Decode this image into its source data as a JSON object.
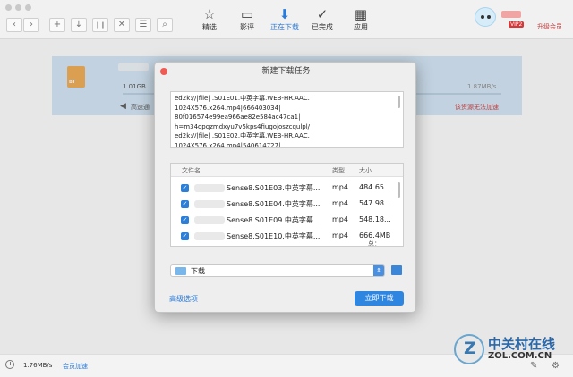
{
  "toolbar": {
    "nav": {
      "back": "‹",
      "forward": "›"
    },
    "actions": [
      {
        "name": "new-task-button",
        "glyph": "+"
      },
      {
        "name": "download-start-button",
        "glyph": "↓"
      },
      {
        "name": "pause-button",
        "glyph": "❙❙"
      },
      {
        "name": "delete-button",
        "glyph": "✕"
      },
      {
        "name": "list-button",
        "glyph": "☰"
      },
      {
        "name": "search-button",
        "glyph": "⌕"
      }
    ],
    "tabs": [
      {
        "label": "精选",
        "icon": "star-icon",
        "glyph": "☆"
      },
      {
        "label": "影评",
        "icon": "comment-icon",
        "glyph": "▭"
      },
      {
        "label": "正在下载",
        "icon": "download-icon",
        "glyph": "⬇"
      },
      {
        "label": "已完成",
        "icon": "check-icon",
        "glyph": "✓"
      },
      {
        "label": "应用",
        "icon": "apps-icon",
        "glyph": "▦"
      }
    ],
    "vip": "VIP2",
    "upgrade": "升级会员"
  },
  "task": {
    "file_icon_label": "BT",
    "size": "1.01GB",
    "speed": "1.87MB/s",
    "progress": 0.0,
    "boost_label": "高速通",
    "warning": "该资源无法加速"
  },
  "status": {
    "speed": "1.76MB/s",
    "member_boost": "会员加速"
  },
  "watermark": {
    "cn": "中关村在线",
    "en": "ZOL.COM.CN"
  },
  "dialog": {
    "title": "新建下载任务",
    "urls": [
      "ed2k://|file|                         .S01E01.中英字幕.WEB-HR.AAC.",
      "1024X576.x264.mp4|666403034|",
      "80f016574e99ea966ae82e584ac47ca1|",
      "h=m34opqzmdxyu7v5kps4fiugojoszcqulpl/",
      "ed2k://|file|                         .S01E02.中英字幕.WEB-HR.AAC.",
      "1024X576.x264.mp4|540614727|"
    ],
    "table": {
      "col_name": "文件名",
      "col_type": "类型",
      "col_size": "大小",
      "rows": [
        {
          "name": "Sense8.S01E03.中英字幕...",
          "type": "mp4",
          "size": "484.65..."
        },
        {
          "name": "Sense8.S01E04.中英字幕...",
          "type": "mp4",
          "size": "547.98..."
        },
        {
          "name": "Sense8.S01E09.中英字幕...",
          "type": "mp4",
          "size": "548.18..."
        },
        {
          "name": "Sense8.S01E10.中英字幕...",
          "type": "mp4",
          "size": "666.4MB"
        }
      ],
      "total": "总：6.46GB"
    },
    "path": "下载",
    "advanced": "高级选项",
    "download_now": "立即下载"
  }
}
